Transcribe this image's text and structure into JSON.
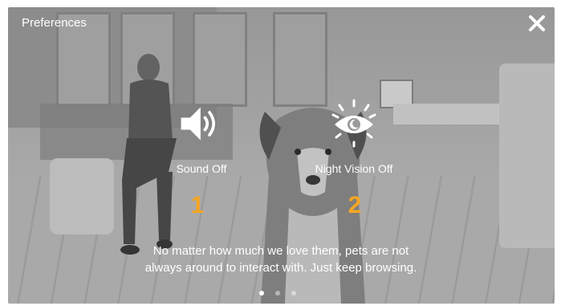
{
  "header": {
    "title": "Preferences"
  },
  "icons": {
    "close": "close-icon",
    "sound": "speaker-icon",
    "night": "eye-night-icon"
  },
  "features": [
    {
      "label": "Sound Off",
      "number": "1"
    },
    {
      "label": "Night Vision Off",
      "number": "2"
    }
  ],
  "caption": {
    "line1": "No matter how much we love them, pets are not",
    "line2": "always around to interact with. Just keep browsing."
  },
  "pagination": {
    "count": 3,
    "active": 1
  },
  "colors": {
    "accent": "#f5a623",
    "text": "#ffffff"
  }
}
